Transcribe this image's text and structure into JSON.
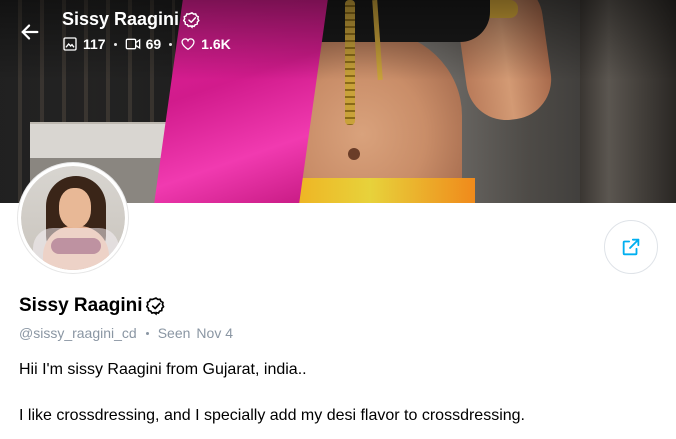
{
  "header": {
    "name": "Sissy Raagini",
    "stats": {
      "photos": "117",
      "videos": "69",
      "likes": "1.6K"
    }
  },
  "profile": {
    "name": "Sissy Raagini",
    "handle": "@sissy_raagini_cd",
    "seen_label": "Seen",
    "seen_date": "Nov 4",
    "bio": [
      "Hii I'm sissy Raagini from Gujarat, india..",
      "I like crossdressing, and I specially add my desi flavor to crossdressing."
    ]
  },
  "icons": {
    "back": "arrow-left-icon",
    "verified": "verified-badge-icon",
    "photos": "image-icon",
    "videos": "video-icon",
    "likes": "heart-icon",
    "share": "share-icon"
  },
  "colors": {
    "accent": "#00aff0",
    "muted": "#8a96a3",
    "saree": "#e5209a"
  }
}
